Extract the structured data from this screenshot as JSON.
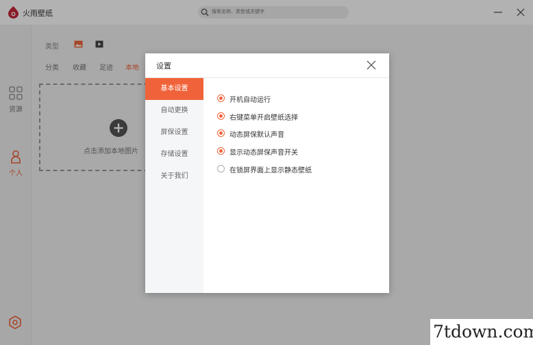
{
  "app": {
    "title": "火雨壁纸",
    "search_placeholder": "搜索名称、类型或关键字"
  },
  "sidebar": {
    "items": [
      {
        "label": "资源",
        "icon": "grid-icon"
      },
      {
        "label": "个人",
        "icon": "person-icon"
      }
    ],
    "bottom_icon": "settings-icon"
  },
  "main": {
    "type_label": "类型",
    "type_icons": [
      "image-icon",
      "video-icon"
    ],
    "tabs": [
      {
        "label": "分类",
        "active": false
      },
      {
        "label": "收藏",
        "active": false
      },
      {
        "label": "足迹",
        "active": false
      },
      {
        "label": "本地",
        "active": true
      }
    ],
    "drop_zone_text": "点击添加本地图片"
  },
  "modal": {
    "title": "设置",
    "nav": [
      {
        "label": "基本设置",
        "active": true
      },
      {
        "label": "自动更换",
        "active": false
      },
      {
        "label": "屏保设置",
        "active": false
      },
      {
        "label": "存储设置",
        "active": false
      },
      {
        "label": "关于我们",
        "active": false
      }
    ],
    "options": [
      {
        "label": "开机自动运行",
        "checked": true
      },
      {
        "label": "右键菜单开启壁纸选择",
        "checked": true
      },
      {
        "label": "动态屏保默认声音",
        "checked": true
      },
      {
        "label": "显示动态屏保声音开关",
        "checked": true
      },
      {
        "label": "在锁屏界面上显示静态壁纸",
        "checked": false
      }
    ]
  },
  "watermark": "7tdown.com",
  "colors": {
    "accent": "#f0633a",
    "sidebar_bg": "#efefef",
    "nav_bg": "#f5f6f8"
  }
}
